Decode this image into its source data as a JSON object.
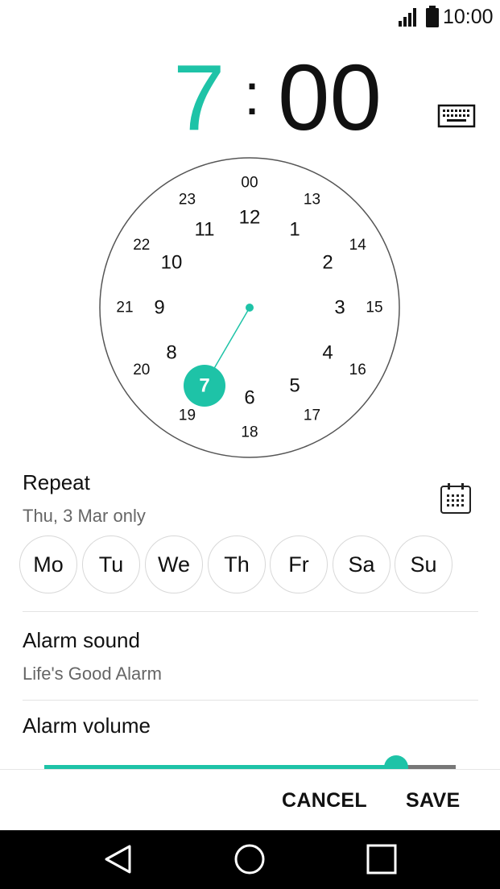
{
  "status_bar": {
    "time": "10:00",
    "icons": [
      "signal-icon",
      "battery-icon"
    ]
  },
  "time_picker": {
    "hour": "7",
    "separator": ":",
    "minute": "00",
    "accent_color": "#1ec3a7",
    "keyboard_toggle_icon": "keyboard-icon"
  },
  "clock": {
    "inner_numbers": [
      "12",
      "1",
      "2",
      "3",
      "4",
      "5",
      "6",
      "7",
      "8",
      "9",
      "10",
      "11"
    ],
    "outer_numbers": [
      "00",
      "13",
      "14",
      "15",
      "16",
      "17",
      "18",
      "19",
      "20",
      "21",
      "22",
      "23"
    ],
    "selected": "7"
  },
  "repeat": {
    "title": "Repeat",
    "subtitle": "Thu, 3 Mar only",
    "calendar_icon": "calendar-icon",
    "days": [
      "Mo",
      "Tu",
      "We",
      "Th",
      "Fr",
      "Sa",
      "Su"
    ]
  },
  "alarm_sound": {
    "title": "Alarm sound",
    "value": "Life's Good Alarm"
  },
  "alarm_volume": {
    "title": "Alarm volume",
    "level": 0.855
  },
  "actions": {
    "cancel_label": "CANCEL",
    "save_label": "SAVE"
  },
  "nav": {
    "icons": [
      "back-icon",
      "home-icon",
      "recent-apps-icon"
    ]
  }
}
